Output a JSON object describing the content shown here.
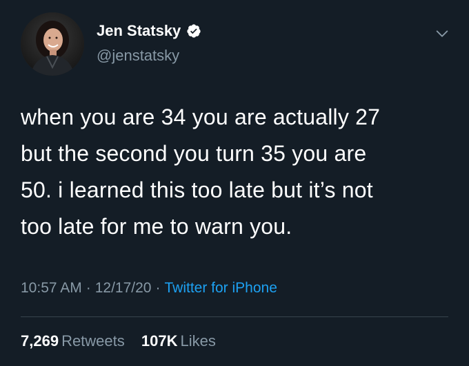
{
  "author": {
    "display_name": "Jen Statsky",
    "handle": "@jenstatsky",
    "verified": true,
    "avatar_icon": "profile-photo"
  },
  "tweet": {
    "lines": [
      "when you are 34 you are actually 27",
      "but the second you turn 35 you are",
      "50. i learned this too late but it’s not",
      "too late for me to warn you."
    ]
  },
  "meta": {
    "time": "10:57 AM",
    "separator": "·",
    "date": "12/17/20",
    "source": "Twitter for iPhone"
  },
  "stats": {
    "retweets_count": "7,269",
    "retweets_label": "Retweets",
    "likes_count": "107K",
    "likes_label": "Likes"
  },
  "colors": {
    "background": "#141d26",
    "secondary_text": "#8899a6",
    "accent": "#1da1f2",
    "divider": "#38444d"
  },
  "icons": {
    "verified": "verified-badge-icon",
    "more": "chevron-down-icon"
  }
}
